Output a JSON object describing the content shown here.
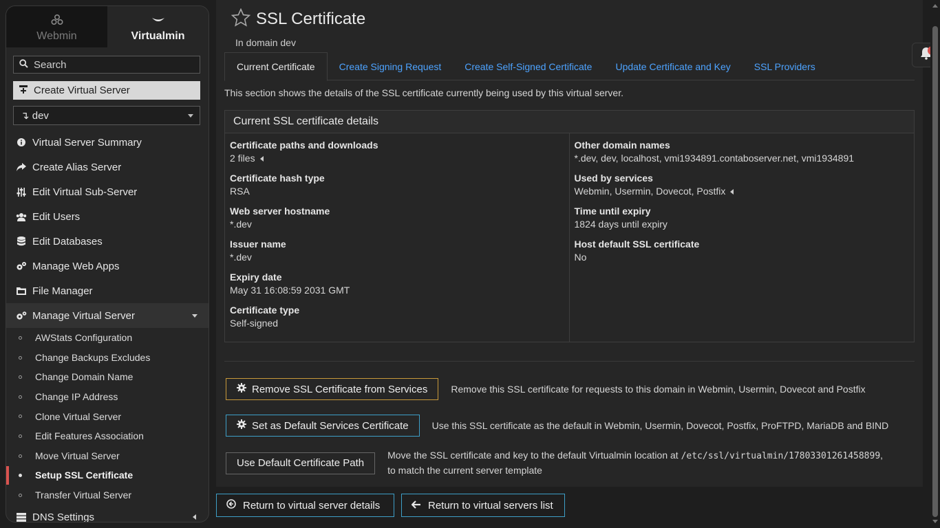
{
  "sidebar": {
    "switcher": {
      "webmin_label": "Webmin",
      "virtualmin_label": "Virtualmin"
    },
    "search_label": "Search",
    "create_label": "Create Virtual Server",
    "domain_value": "↴ dev",
    "menu": [
      {
        "label": "Virtual Server Summary",
        "icon": "info-icon"
      },
      {
        "label": "Create Alias Server",
        "icon": "share-icon"
      },
      {
        "label": "Edit Virtual Sub-Server",
        "icon": "sliders-icon"
      },
      {
        "label": "Edit Users",
        "icon": "users-icon"
      },
      {
        "label": "Edit Databases",
        "icon": "database-icon"
      },
      {
        "label": "Manage Web Apps",
        "icon": "cogs-icon"
      },
      {
        "label": "File Manager",
        "icon": "folder-icon"
      }
    ],
    "manage_label": "Manage Virtual Server",
    "submenu": [
      "AWStats Configuration",
      "Change Backups Excludes",
      "Change Domain Name",
      "Change IP Address",
      "Clone Virtual Server",
      "Edit Features Association",
      "Move Virtual Server",
      "Setup SSL Certificate",
      "Transfer Virtual Server"
    ],
    "dns_label": "DNS Settings"
  },
  "header": {
    "title": "SSL Certificate",
    "subtitle": "In domain dev"
  },
  "tabs": [
    "Current Certificate",
    "Create Signing Request",
    "Create Self-Signed Certificate",
    "Update Certificate and Key",
    "SSL Providers"
  ],
  "description": "This section shows the details of the SSL certificate currently being used by this virtual server.",
  "panel": {
    "title": "Current SSL certificate details",
    "left": [
      {
        "label": "Certificate paths and downloads",
        "value": "2 files"
      },
      {
        "label": "Certificate hash type",
        "value": "RSA"
      },
      {
        "label": "Web server hostname",
        "value": "*.dev"
      },
      {
        "label": "Issuer name",
        "value": "*.dev"
      },
      {
        "label": "Expiry date",
        "value": "May 31 16:08:59 2031 GMT"
      },
      {
        "label": "Certificate type",
        "value": "Self-signed"
      }
    ],
    "right": [
      {
        "label": "Other domain names",
        "value": "*.dev, dev, localhost, vmi1934891.contaboserver.net, vmi1934891"
      },
      {
        "label": "Used by services",
        "value": "Webmin, Usermin, Dovecot, Postfix"
      },
      {
        "label": "Time until expiry",
        "value": "1824 days until expiry"
      },
      {
        "label": "Host default SSL certificate",
        "value": "No"
      }
    ]
  },
  "actions": {
    "remove": {
      "label": "Remove SSL Certificate from Services",
      "desc": "Remove this SSL certificate for requests to this domain in Webmin, Usermin, Dovecot and Postfix"
    },
    "set_default": {
      "label": "Set as Default Services Certificate",
      "desc": "Use this SSL certificate as the default in Webmin, Usermin, Dovecot, Postfix, ProFTPD, MariaDB and BIND"
    },
    "use_path": {
      "label": "Use Default Certificate Path",
      "desc_a": "Move the SSL certificate and key to the default Virtualmin location at",
      "path": "/etc/ssl/virtualmin/17803301261458899",
      "desc_b": ",",
      "desc_c": "to match the current server template"
    }
  },
  "bottom": {
    "return_details": "Return to virtual server details",
    "return_list": "Return to virtual servers list"
  },
  "notifications": {
    "count": "1"
  },
  "colors": {
    "link": "#4da3ff",
    "warning_border": "#c99a3a",
    "info_border": "#3ea0c9",
    "active_marker": "#d9534f"
  }
}
